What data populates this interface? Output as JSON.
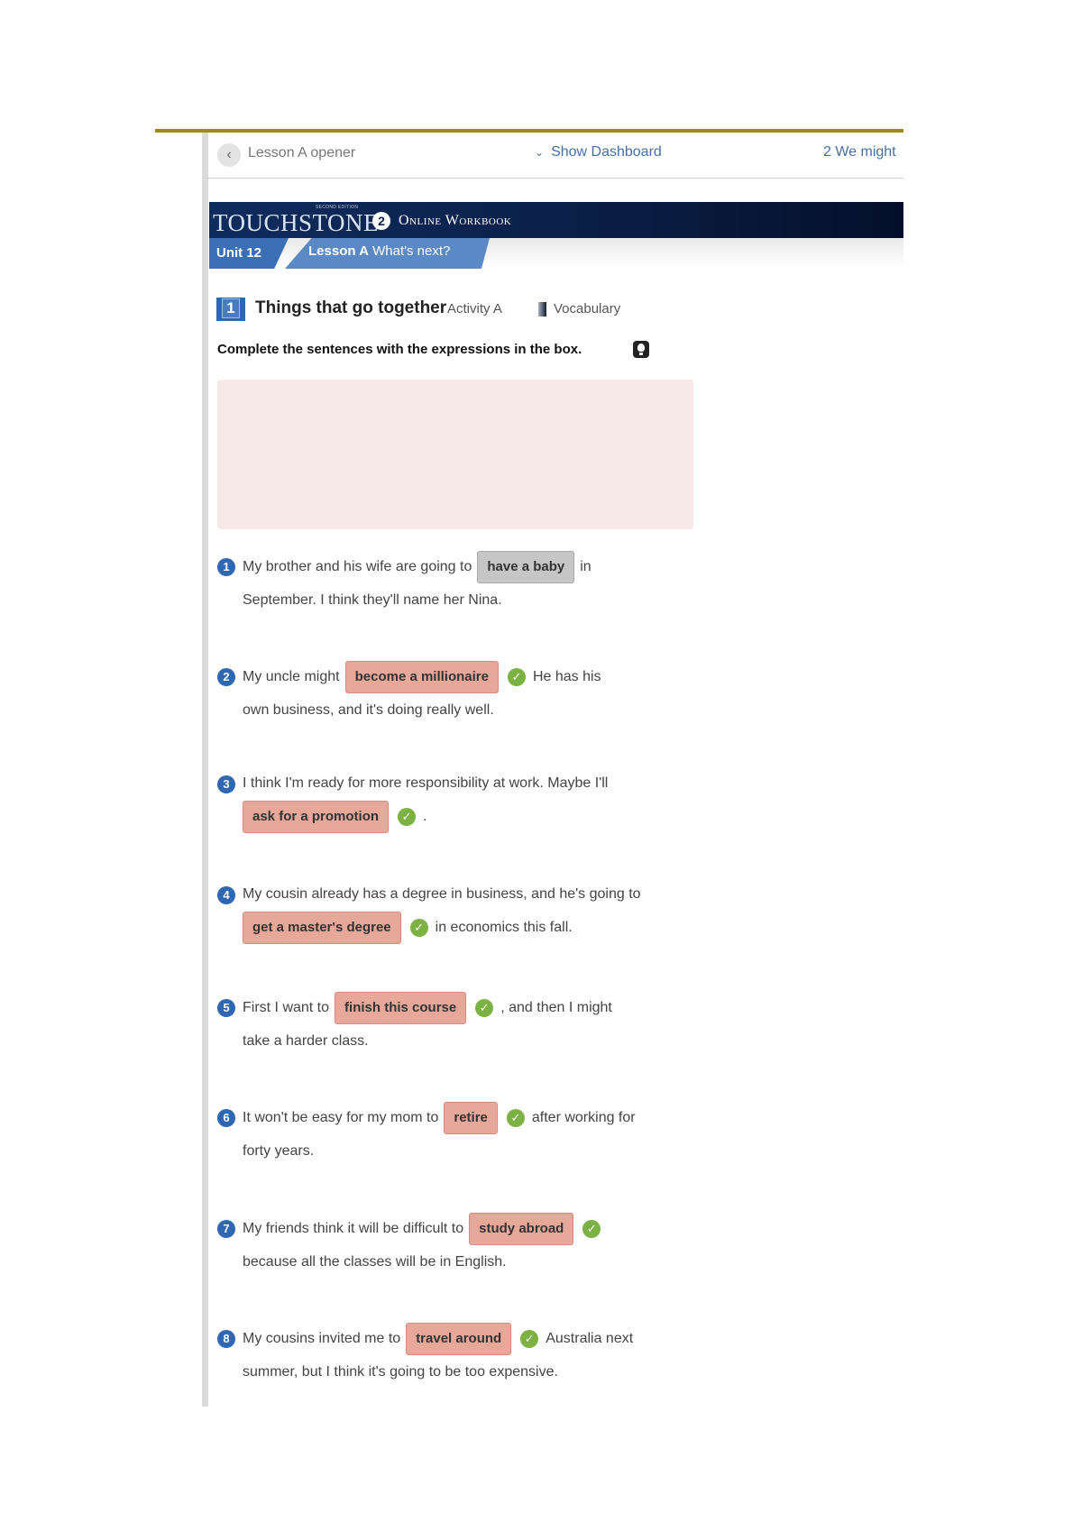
{
  "nav": {
    "back_icon": "chevron-left-icon",
    "prev_label": "Lesson A opener",
    "dashboard_label": "Show Dashboard",
    "dashboard_icon": "chevron-down-icon",
    "next_label": "2 We might"
  },
  "banner": {
    "brand": "TOUCHSTONE",
    "brand_small": "SECOND EDITION",
    "level": "2",
    "title": "Online Workbook"
  },
  "tabs": {
    "unit": "Unit 12",
    "lesson_bold": "Lesson A",
    "lesson_title": "What's next?"
  },
  "activity": {
    "number": "1",
    "title": "Things that go together",
    "sub": "Activity A",
    "category": "Vocabulary",
    "instruction": "Complete the sentences with the expressions in the box."
  },
  "items": [
    {
      "num": "1",
      "before": "My brother and his wife are going to",
      "answer": "have a baby",
      "after": "in",
      "line2": "September.   I think they'll name her Nina.",
      "checked": false
    },
    {
      "num": "2",
      "before": "My uncle might",
      "answer": "become a millionaire",
      "after": "He has his",
      "line2": "own business, and it's doing really well.",
      "checked": true
    },
    {
      "num": "3",
      "before": "I think I'm ready for more responsibility at work. Maybe I'll",
      "answer": "ask for a promotion",
      "after": ".",
      "checked": true
    },
    {
      "num": "4",
      "before": "My cousin already has a degree in business, and he's going to",
      "answer": "get a master's degree",
      "after": "in economics this fall.",
      "checked": true
    },
    {
      "num": "5",
      "before": "First I want to",
      "answer": "finish this course",
      "after": ", and then I might",
      "line2": "take a harder class.",
      "checked": true
    },
    {
      "num": "6",
      "before": "It won't be easy for my mom to",
      "answer": "retire",
      "after": "after working for",
      "line2": "forty years.",
      "checked": true
    },
    {
      "num": "7",
      "before": "My friends think it will be difficult to",
      "answer": "study abroad",
      "after": "",
      "line2": "because all the classes will be in English.",
      "checked": true
    },
    {
      "num": "8",
      "before": "My cousins invited me to",
      "answer": "travel around",
      "after": "Australia next",
      "line2": "summer, but I think it's going to be too expensive.",
      "checked": true
    }
  ]
}
